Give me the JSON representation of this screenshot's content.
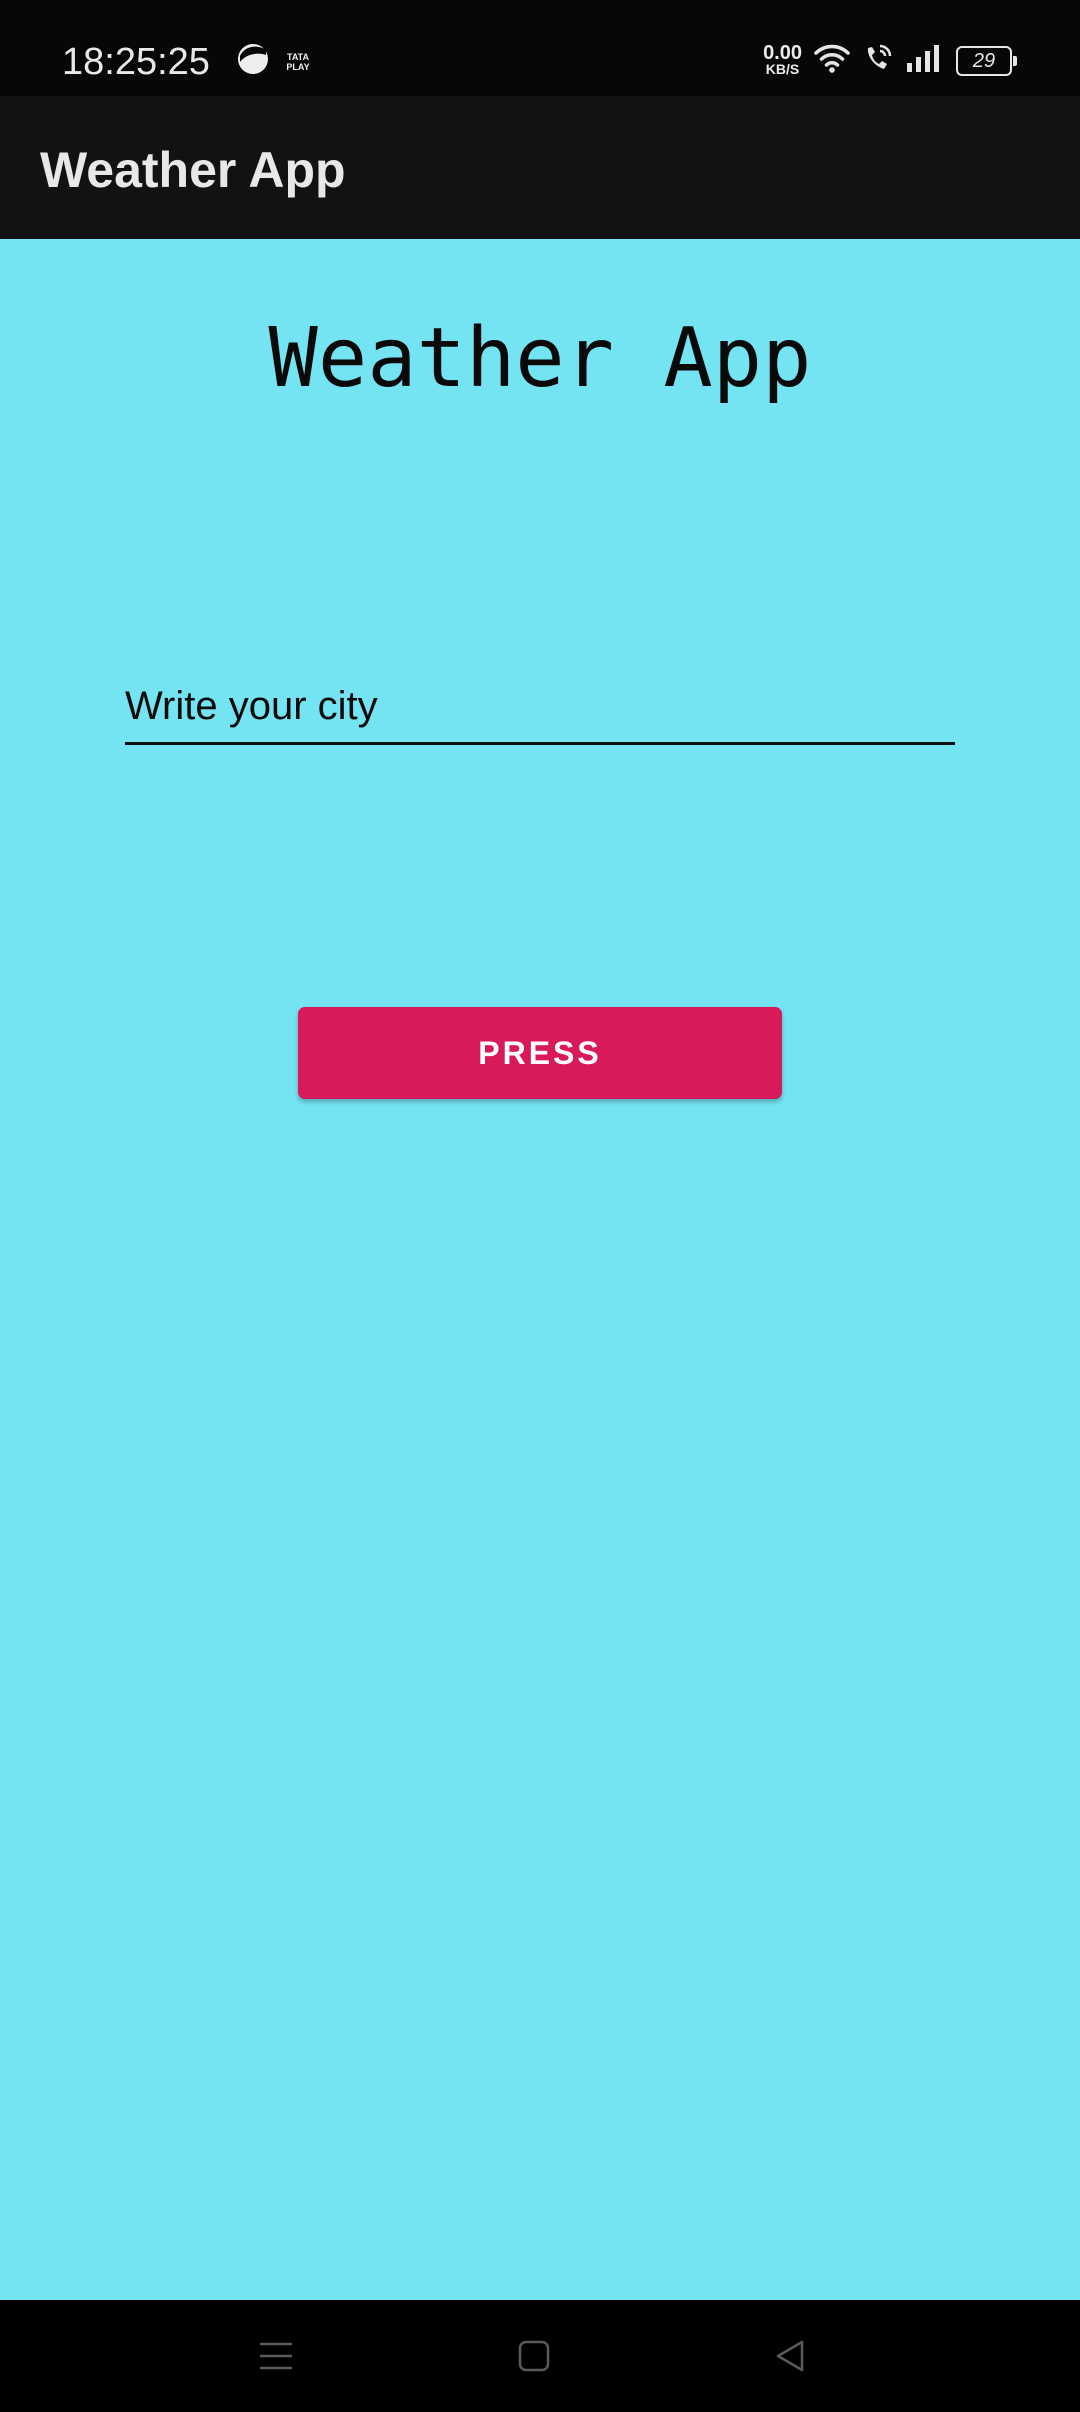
{
  "status_bar": {
    "time": "18:25:25",
    "tata_play_line1": "TATA",
    "tata_play_line2": "PLAY",
    "net_speed_value": "0.00",
    "net_speed_unit": "KB/S",
    "battery_level": "29",
    "icons": [
      "moon-app-icon",
      "tata-play-icon",
      "wifi-icon",
      "wifi-calling-icon",
      "signal-icon",
      "battery-icon"
    ]
  },
  "app_bar": {
    "title": "Weather App"
  },
  "main": {
    "heading": "Weather App",
    "city_input": {
      "placeholder": "Write your city",
      "value": ""
    },
    "press_button_label": "PRESS"
  },
  "nav_bar": {
    "buttons": [
      "menu-icon",
      "home-icon",
      "back-icon"
    ]
  },
  "colors": {
    "background": "#74e3f2",
    "app_bar": "#121212",
    "status_bar": "#070707",
    "button": "#d81a5b",
    "nav_bar": "#000000"
  }
}
